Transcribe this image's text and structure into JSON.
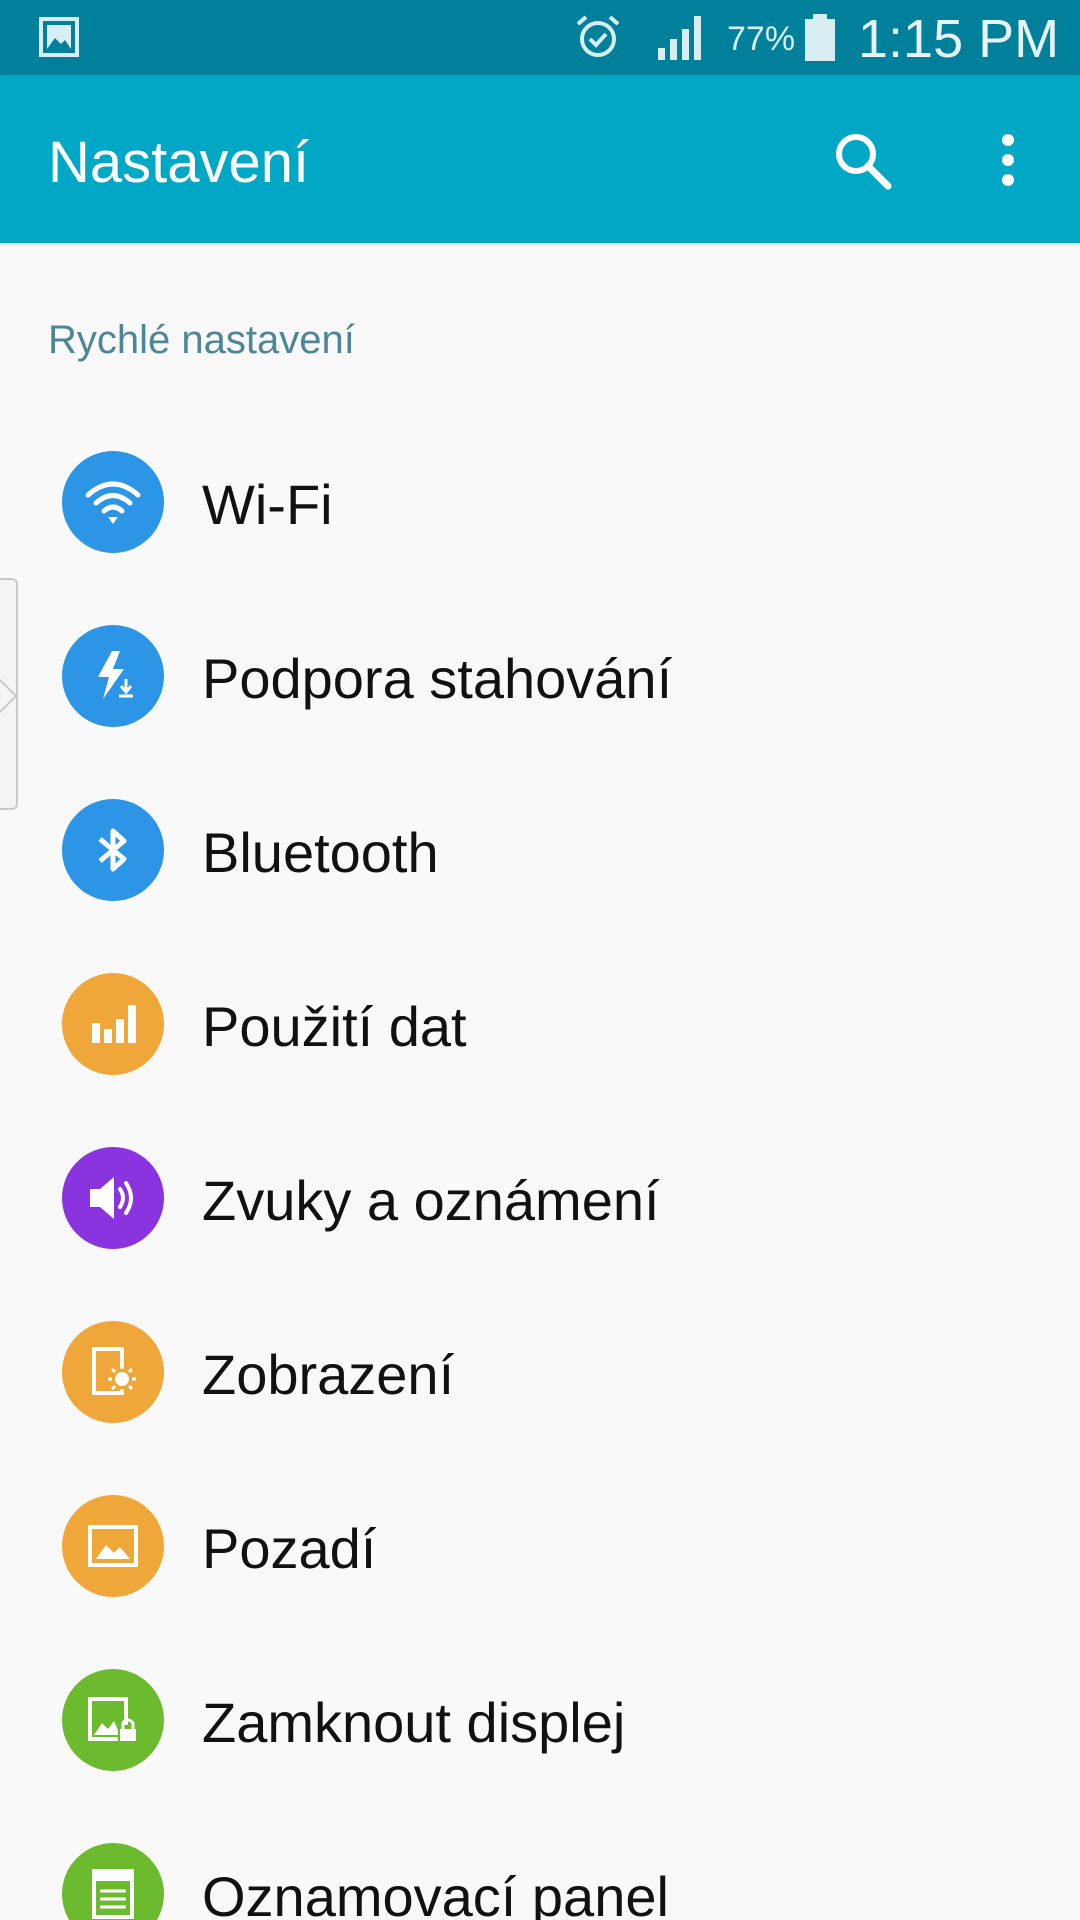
{
  "status_bar": {
    "battery_percent": "77%",
    "time": "1:15 PM",
    "icons": [
      "gallery-icon",
      "alarm-icon",
      "signal-icon",
      "battery-icon"
    ]
  },
  "app_bar": {
    "title": "Nastavení",
    "actions": [
      "search-icon",
      "more-vert-icon"
    ]
  },
  "section": {
    "title": "Rychlé nastavení"
  },
  "items": [
    {
      "label": "Wi-Fi",
      "icon": "wifi-icon",
      "color": "#2d95e6"
    },
    {
      "label": "Podpora stahování",
      "icon": "download-booster-icon",
      "color": "#2d95e6"
    },
    {
      "label": "Bluetooth",
      "icon": "bluetooth-icon",
      "color": "#2d95e6"
    },
    {
      "label": "Použití dat",
      "icon": "data-usage-icon",
      "color": "#efa73a"
    },
    {
      "label": "Zvuky a oznámení",
      "icon": "sound-icon",
      "color": "#8a34df"
    },
    {
      "label": "Zobrazení",
      "icon": "display-icon",
      "color": "#efa73a"
    },
    {
      "label": "Pozadí",
      "icon": "wallpaper-icon",
      "color": "#efa73a"
    },
    {
      "label": "Zamknout displej",
      "icon": "lock-screen-icon",
      "color": "#6cba2e"
    },
    {
      "label": "Oznamovací panel",
      "icon": "notification-panel-icon",
      "color": "#6cba2e"
    }
  ],
  "colors": {
    "status_bar": "#00809a",
    "app_bar": "#00a8c6",
    "section_header": "#4d8796",
    "background": "#f9f9f9"
  }
}
